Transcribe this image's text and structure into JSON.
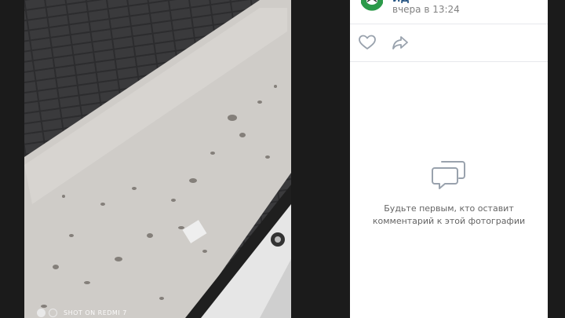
{
  "post": {
    "author_name": "ИД",
    "date": "вчера в 13:24"
  },
  "actions": [
    {
      "id": "like",
      "icon": "heart-icon"
    },
    {
      "id": "share",
      "icon": "share-arrow-icon"
    }
  ],
  "comments": {
    "empty_icon": "speech-bubbles-icon",
    "empty_text": "Будьте первым, кто оставит комментарий к этой фотографии"
  },
  "photo": {
    "watermark": "SHOT ON REDMI 7"
  },
  "colors": {
    "panel_background": "#ffffff",
    "link_blue": "#2a5885",
    "muted_text": "#828282",
    "icon_blue": "#99a2ad"
  }
}
